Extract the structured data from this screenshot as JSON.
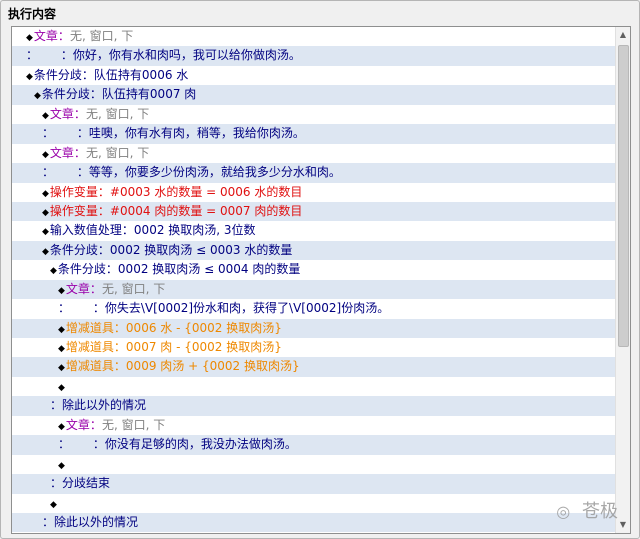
{
  "panel": {
    "title": "执行内容"
  },
  "rows": [
    {
      "indent": 1,
      "bullet": true,
      "segments": [
        {
          "t": "文章：",
          "c": "purple"
        },
        {
          "t": "无, 窗口, 下",
          "c": "gray"
        }
      ]
    },
    {
      "indent": 1,
      "bullet": false,
      "segments": [
        {
          "t": "：",
          "c": "navy"
        },
        {
          "t": "      ：你好，你有水和肉吗，我可以给你做肉汤。",
          "c": "navy"
        }
      ]
    },
    {
      "indent": 1,
      "bullet": true,
      "segments": [
        {
          "t": "条件分歧：队伍持有0006 水",
          "c": "navy"
        }
      ]
    },
    {
      "indent": 2,
      "bullet": true,
      "segments": [
        {
          "t": "条件分歧：队伍持有0007 肉",
          "c": "navy"
        }
      ]
    },
    {
      "indent": 3,
      "bullet": true,
      "segments": [
        {
          "t": "文章：",
          "c": "purple"
        },
        {
          "t": "无, 窗口, 下",
          "c": "gray"
        }
      ]
    },
    {
      "indent": 3,
      "bullet": false,
      "segments": [
        {
          "t": "：",
          "c": "navy"
        },
        {
          "t": "      ：哇噢，你有水有肉，稍等，我给你肉汤。",
          "c": "navy"
        }
      ]
    },
    {
      "indent": 3,
      "bullet": true,
      "segments": [
        {
          "t": "文章：",
          "c": "purple"
        },
        {
          "t": "无, 窗口, 下",
          "c": "gray"
        }
      ]
    },
    {
      "indent": 3,
      "bullet": false,
      "segments": [
        {
          "t": "：",
          "c": "navy"
        },
        {
          "t": "      ：等等，你要多少份肉汤，就给我多少分水和肉。",
          "c": "navy"
        }
      ]
    },
    {
      "indent": 3,
      "bullet": true,
      "segments": [
        {
          "t": "操作变量：#0003 水的数量 = 0006 水的数目",
          "c": "red"
        }
      ]
    },
    {
      "indent": 3,
      "bullet": true,
      "segments": [
        {
          "t": "操作变量：#0004 肉的数量 = 0007 肉的数目",
          "c": "red"
        }
      ]
    },
    {
      "indent": 3,
      "bullet": true,
      "segments": [
        {
          "t": "输入数值处理：0002 换取肉汤, 3位数",
          "c": "navy"
        }
      ]
    },
    {
      "indent": 3,
      "bullet": true,
      "segments": [
        {
          "t": "条件分歧：0002 换取肉汤 ≤ 0003 水的数量",
          "c": "navy"
        }
      ]
    },
    {
      "indent": 4,
      "bullet": true,
      "segments": [
        {
          "t": "条件分歧：0002 换取肉汤 ≤ 0004 肉的数量",
          "c": "navy"
        }
      ]
    },
    {
      "indent": 5,
      "bullet": true,
      "segments": [
        {
          "t": "文章：",
          "c": "purple"
        },
        {
          "t": "无, 窗口, 下",
          "c": "gray"
        }
      ]
    },
    {
      "indent": 5,
      "bullet": false,
      "segments": [
        {
          "t": "：",
          "c": "navy"
        },
        {
          "t": "      ：你失去\\V[0002]份水和肉，获得了\\V[0002]份肉汤。",
          "c": "navy"
        }
      ]
    },
    {
      "indent": 5,
      "bullet": true,
      "segments": [
        {
          "t": "增减道具：0006 水 - {0002 换取肉汤}",
          "c": "orange"
        }
      ]
    },
    {
      "indent": 5,
      "bullet": true,
      "segments": [
        {
          "t": "增减道具：0007 肉 - {0002 换取肉汤}",
          "c": "orange"
        }
      ]
    },
    {
      "indent": 5,
      "bullet": true,
      "segments": [
        {
          "t": "增减道具：0009 肉汤 + {0002 换取肉汤}",
          "c": "orange"
        }
      ]
    },
    {
      "indent": 5,
      "bullet": true,
      "segments": []
    },
    {
      "indent": 4,
      "bullet": false,
      "segments": [
        {
          "t": "：除此以外的情况",
          "c": "navy"
        }
      ]
    },
    {
      "indent": 5,
      "bullet": true,
      "segments": [
        {
          "t": "文章：",
          "c": "purple"
        },
        {
          "t": "无, 窗口, 下",
          "c": "gray"
        }
      ]
    },
    {
      "indent": 5,
      "bullet": false,
      "segments": [
        {
          "t": "：",
          "c": "navy"
        },
        {
          "t": "      ：你没有足够的肉，我没办法做肉汤。",
          "c": "navy"
        }
      ]
    },
    {
      "indent": 5,
      "bullet": true,
      "segments": []
    },
    {
      "indent": 4,
      "bullet": false,
      "segments": [
        {
          "t": "：分歧结束",
          "c": "navy"
        }
      ]
    },
    {
      "indent": 4,
      "bullet": true,
      "segments": []
    },
    {
      "indent": 3,
      "bullet": false,
      "segments": [
        {
          "t": "：除此以外的情况",
          "c": "navy"
        }
      ]
    }
  ],
  "scrollbar": {
    "up_icon": "arrow-up-icon",
    "down_icon": "arrow-down-icon"
  },
  "watermark": {
    "text": "苍极",
    "icon": "wechat-icon"
  },
  "colors": {
    "navy": "#000080",
    "red": "#e01010",
    "orange": "#ee8800",
    "gray": "#808080",
    "purple": "#9900aa",
    "row_alt": "#dde6f2"
  }
}
